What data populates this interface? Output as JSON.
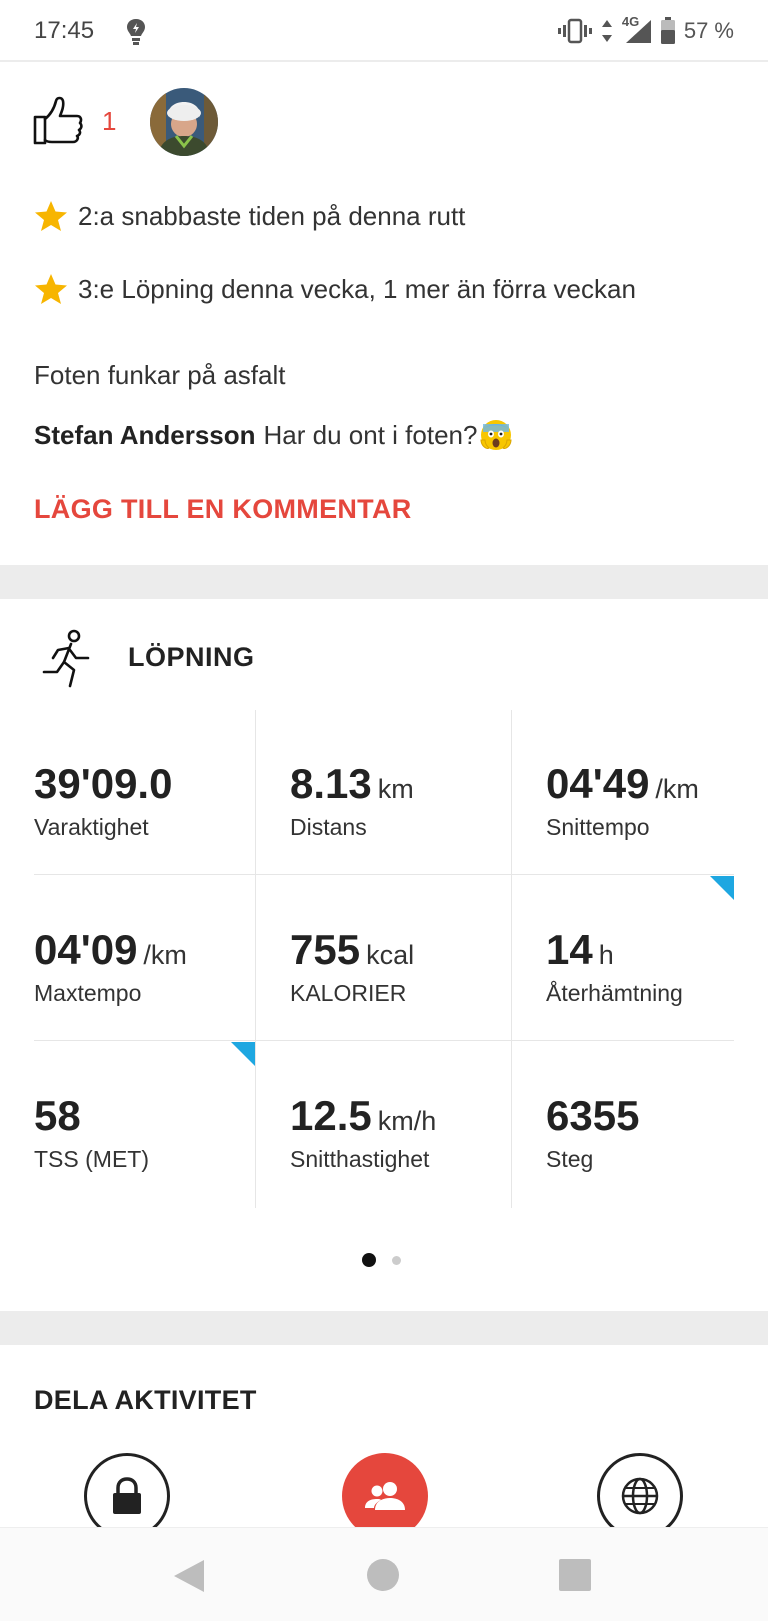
{
  "status_bar": {
    "time": "17:45",
    "network": "4G",
    "battery": "57 %",
    "icons": [
      "lightbulb-icon",
      "vibrate-icon",
      "data-arrows-icon",
      "signal-icon",
      "battery-icon"
    ]
  },
  "social": {
    "like_count": "1",
    "achievements": [
      {
        "icon": "star-icon",
        "text": "2:a snabbaste tiden på denna rutt"
      },
      {
        "icon": "star-icon",
        "text": "3:e Löpning denna vecka, 1 mer än förra veckan"
      }
    ],
    "description": "Foten funkar på asfalt",
    "comment": {
      "author": "Stefan Andersson",
      "text": "Har du ont i foten?"
    },
    "add_comment_label": "LÄGG TILL EN KOMMENTAR"
  },
  "activity": {
    "title": "LÖPNING",
    "icon": "running-icon",
    "stats": [
      {
        "value": "39'09.0",
        "unit": "",
        "label": "Varaktighet"
      },
      {
        "value": "8.13",
        "unit": "km",
        "label": "Distans"
      },
      {
        "value": "04'49",
        "unit": "/km",
        "label": "Snittempo"
      },
      {
        "value": "04'09",
        "unit": "/km",
        "label": "Maxtempo"
      },
      {
        "value": "755",
        "unit": "kcal",
        "label": "KALORIER"
      },
      {
        "value": "14",
        "unit": "h",
        "label": "Återhämtning"
      },
      {
        "value": "58",
        "unit": "",
        "label": "TSS (MET)"
      },
      {
        "value": "12.5",
        "unit": "km/h",
        "label": "Snitthastighet"
      },
      {
        "value": "6355",
        "unit": "",
        "label": "Steg"
      }
    ],
    "pager": {
      "pages": 2,
      "current": 1
    }
  },
  "share": {
    "title": "DELA AKTIVITET",
    "options": [
      "lock-icon",
      "followers-icon",
      "globe-icon"
    ]
  },
  "colors": {
    "accent": "#e5473d",
    "info_marker": "#1ea7e1",
    "divider": "#ececec"
  }
}
